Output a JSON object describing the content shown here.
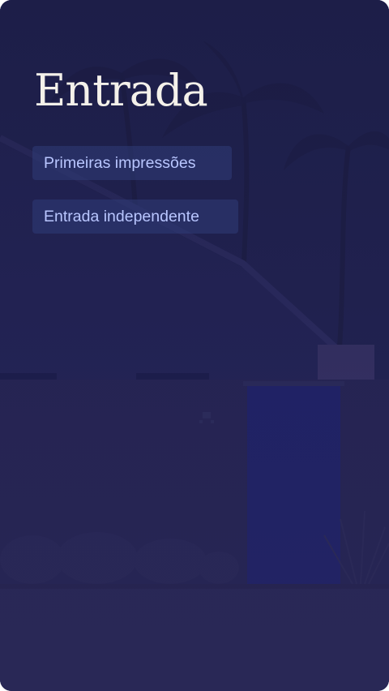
{
  "page": {
    "title": "Entrada"
  },
  "chips": [
    {
      "label": "Primeiras impressões"
    },
    {
      "label": "Entrada independente"
    }
  ],
  "background": {
    "subject": "house-entrance-with-palm-trees"
  },
  "colors": {
    "overlay": "#22214a",
    "title": "#f4f1ea",
    "chip_bg": "#303c78",
    "chip_text": "#b9c6ff",
    "door": "#1e2270"
  }
}
